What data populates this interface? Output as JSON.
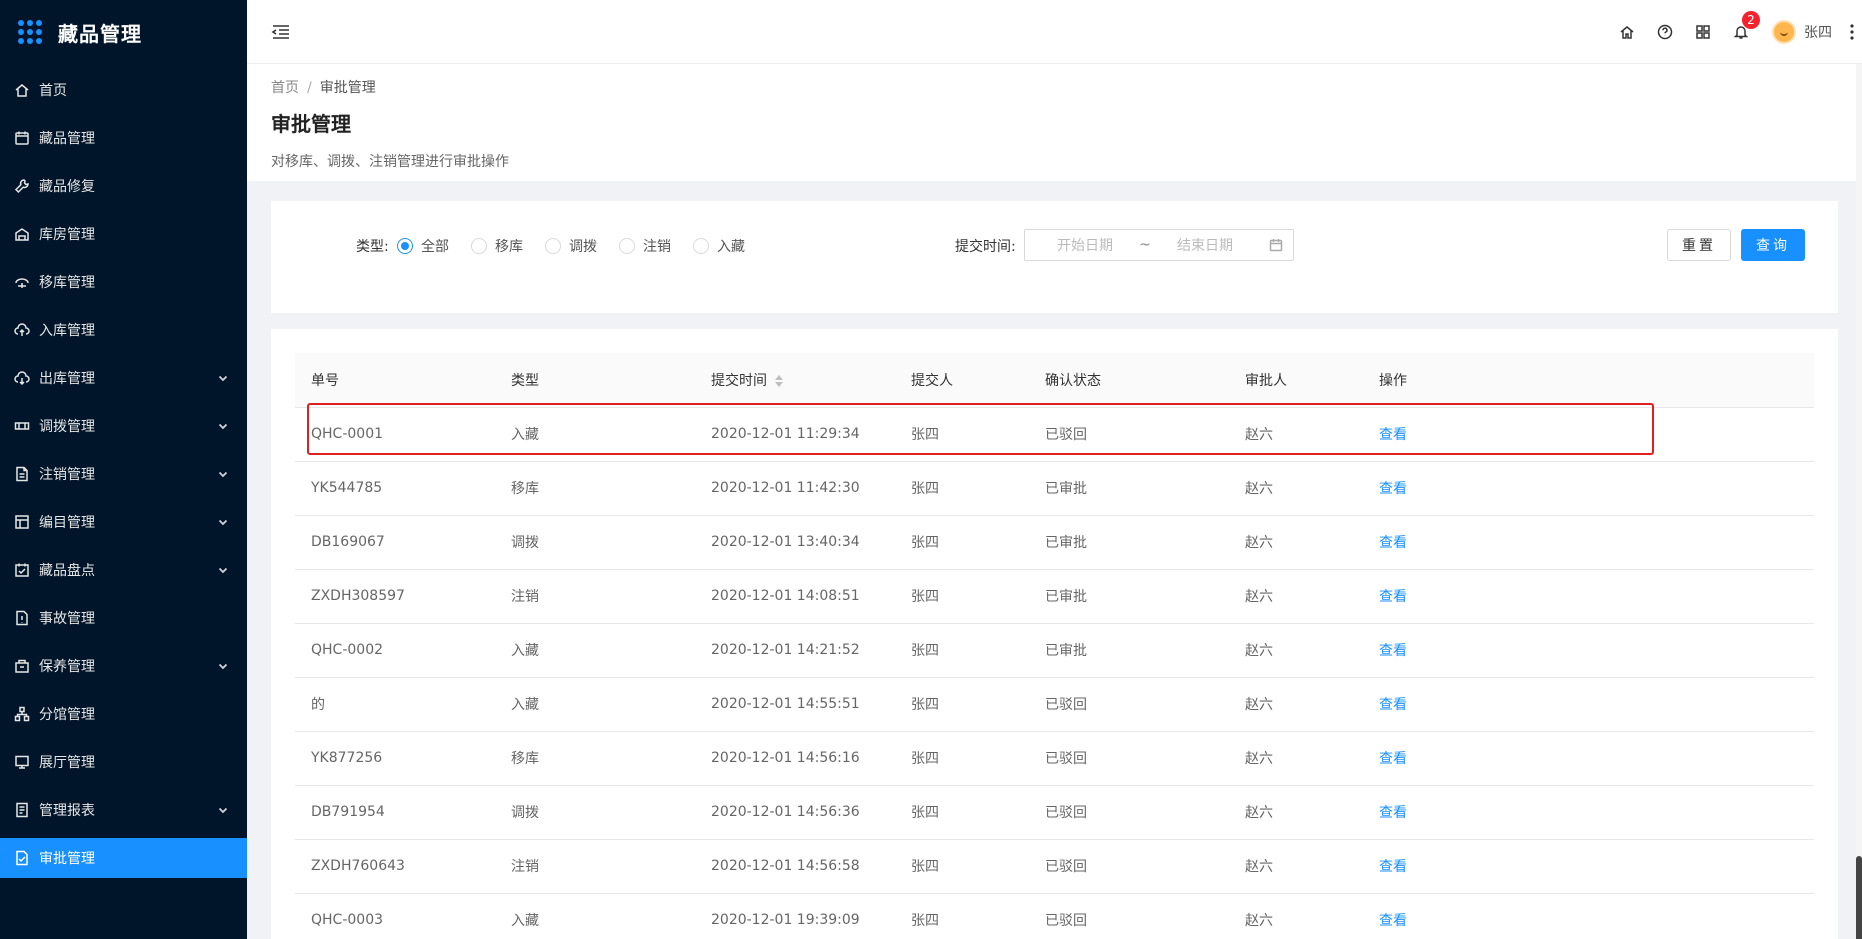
{
  "app": {
    "title": "藏品管理"
  },
  "sidebar": {
    "items": [
      {
        "label": "首页",
        "icon": "home-icon",
        "has_children": false,
        "active": false
      },
      {
        "label": "藏品管理",
        "icon": "calendar-icon",
        "has_children": false,
        "active": false
      },
      {
        "label": "藏品修复",
        "icon": "wrench-icon",
        "has_children": false,
        "active": false
      },
      {
        "label": "库房管理",
        "icon": "warehouse-icon",
        "has_children": false,
        "active": false
      },
      {
        "label": "移库管理",
        "icon": "transfer-icon",
        "has_children": false,
        "active": false
      },
      {
        "label": "入库管理",
        "icon": "upload-cloud-icon",
        "has_children": false,
        "active": false
      },
      {
        "label": "出库管理",
        "icon": "download-cloud-icon",
        "has_children": true,
        "active": false
      },
      {
        "label": "调拨管理",
        "icon": "allocate-icon",
        "has_children": true,
        "active": false
      },
      {
        "label": "注销管理",
        "icon": "document-icon",
        "has_children": true,
        "active": false
      },
      {
        "label": "编目管理",
        "icon": "catalog-icon",
        "has_children": true,
        "active": false
      },
      {
        "label": "藏品盘点",
        "icon": "inventory-icon",
        "has_children": true,
        "active": false
      },
      {
        "label": "事故管理",
        "icon": "incident-icon",
        "has_children": false,
        "active": false
      },
      {
        "label": "保养管理",
        "icon": "maintenance-icon",
        "has_children": true,
        "active": false
      },
      {
        "label": "分馆管理",
        "icon": "branch-icon",
        "has_children": false,
        "active": false
      },
      {
        "label": "展厅管理",
        "icon": "monitor-icon",
        "has_children": false,
        "active": false
      },
      {
        "label": "管理报表",
        "icon": "report-icon",
        "has_children": true,
        "active": false
      },
      {
        "label": "审批管理",
        "icon": "approval-icon",
        "has_children": false,
        "active": true
      }
    ]
  },
  "header": {
    "notification_count": "2",
    "user_name": "张四",
    "icons": [
      "home-icon",
      "help-icon",
      "apps-icon",
      "bell-icon"
    ]
  },
  "page": {
    "breadcrumb": {
      "home": "首页",
      "separator": "/",
      "current": "审批管理"
    },
    "title": "审批管理",
    "description": "对移库、调拨、注销管理进行审批操作"
  },
  "filter": {
    "type_label": "类型:",
    "type_options": [
      {
        "label": "全部",
        "checked": true
      },
      {
        "label": "移库",
        "checked": false
      },
      {
        "label": "调拨",
        "checked": false
      },
      {
        "label": "注销",
        "checked": false
      },
      {
        "label": "入藏",
        "checked": false
      }
    ],
    "time_label": "提交时间:",
    "start_placeholder": "开始日期",
    "range_separator": "~",
    "end_placeholder": "结束日期",
    "reset_label": "重置",
    "query_label": "查询"
  },
  "table": {
    "columns": [
      "单号",
      "类型",
      "提交时间",
      "提交人",
      "确认状态",
      "审批人",
      "操作"
    ],
    "rows": [
      {
        "id": "QHC-0001",
        "type": "入藏",
        "time": "2020-12-01 11:29:34",
        "submitter": "张四",
        "status": "已驳回",
        "approver": "赵六",
        "action": "查看"
      },
      {
        "id": "YK544785",
        "type": "移库",
        "time": "2020-12-01 11:42:30",
        "submitter": "张四",
        "status": "已审批",
        "approver": "赵六",
        "action": "查看"
      },
      {
        "id": "DB169067",
        "type": "调拨",
        "time": "2020-12-01 13:40:34",
        "submitter": "张四",
        "status": "已审批",
        "approver": "赵六",
        "action": "查看"
      },
      {
        "id": "ZXDH308597",
        "type": "注销",
        "time": "2020-12-01 14:08:51",
        "submitter": "张四",
        "status": "已审批",
        "approver": "赵六",
        "action": "查看"
      },
      {
        "id": "QHC-0002",
        "type": "入藏",
        "time": "2020-12-01 14:21:52",
        "submitter": "张四",
        "status": "已审批",
        "approver": "赵六",
        "action": "查看"
      },
      {
        "id": "的",
        "type": "入藏",
        "time": "2020-12-01 14:55:51",
        "submitter": "张四",
        "status": "已驳回",
        "approver": "赵六",
        "action": "查看"
      },
      {
        "id": "YK877256",
        "type": "移库",
        "time": "2020-12-01 14:56:16",
        "submitter": "张四",
        "status": "已驳回",
        "approver": "赵六",
        "action": "查看"
      },
      {
        "id": "DB791954",
        "type": "调拨",
        "time": "2020-12-01 14:56:36",
        "submitter": "张四",
        "status": "已驳回",
        "approver": "赵六",
        "action": "查看"
      },
      {
        "id": "ZXDH760643",
        "type": "注销",
        "time": "2020-12-01 14:56:58",
        "submitter": "张四",
        "status": "已驳回",
        "approver": "赵六",
        "action": "查看"
      },
      {
        "id": "QHC-0003",
        "type": "入藏",
        "time": "2020-12-01 19:39:09",
        "submitter": "张四",
        "status": "已驳回",
        "approver": "赵六",
        "action": "查看"
      }
    ]
  },
  "colors": {
    "sidebar_bg": "#001529",
    "accent": "#1890ff",
    "highlight": "#e02020",
    "badge": "#f5222d"
  }
}
